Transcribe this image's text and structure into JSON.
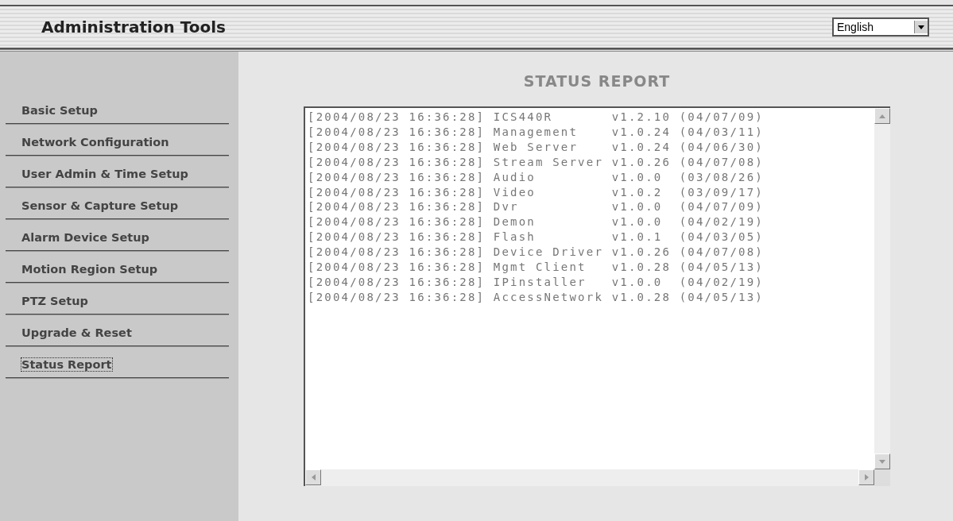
{
  "header": {
    "title": "Administration Tools",
    "language": "English"
  },
  "sidebar": {
    "items": [
      {
        "label": "Basic Setup",
        "selected": false
      },
      {
        "label": "Network Configuration",
        "selected": false
      },
      {
        "label": "User Admin & Time Setup",
        "selected": false
      },
      {
        "label": "Sensor & Capture Setup",
        "selected": false
      },
      {
        "label": "Alarm Device Setup",
        "selected": false
      },
      {
        "label": "Motion Region Setup",
        "selected": false
      },
      {
        "label": "PTZ Setup",
        "selected": false
      },
      {
        "label": "Upgrade & Reset",
        "selected": false
      },
      {
        "label": "Status Report",
        "selected": true
      }
    ]
  },
  "main": {
    "heading": "STATUS REPORT",
    "log_lines": [
      "[2004/08/23 16:36:28] ICS440R       v1.2.10 (04/07/09)",
      "[2004/08/23 16:36:28] Management    v1.0.24 (04/03/11)",
      "[2004/08/23 16:36:28] Web Server    v1.0.24 (04/06/30)",
      "[2004/08/23 16:36:28] Stream Server v1.0.26 (04/07/08)",
      "[2004/08/23 16:36:28] Audio         v1.0.0  (03/08/26)",
      "[2004/08/23 16:36:28] Video         v1.0.2  (03/09/17)",
      "[2004/08/23 16:36:28] Dvr           v1.0.0  (04/07/09)",
      "[2004/08/23 16:36:28] Demon         v1.0.0  (04/02/19)",
      "[2004/08/23 16:36:28] Flash         v1.0.1  (04/03/05)",
      "[2004/08/23 16:36:28] Device Driver v1.0.26 (04/07/08)",
      "[2004/08/23 16:36:28] Mgmt Client   v1.0.28 (04/05/13)",
      "[2004/08/23 16:36:28] IPinstaller   v1.0.0  (04/02/19)",
      "[2004/08/23 16:36:28] AccessNetwork v1.0.28 (04/05/13)"
    ]
  }
}
